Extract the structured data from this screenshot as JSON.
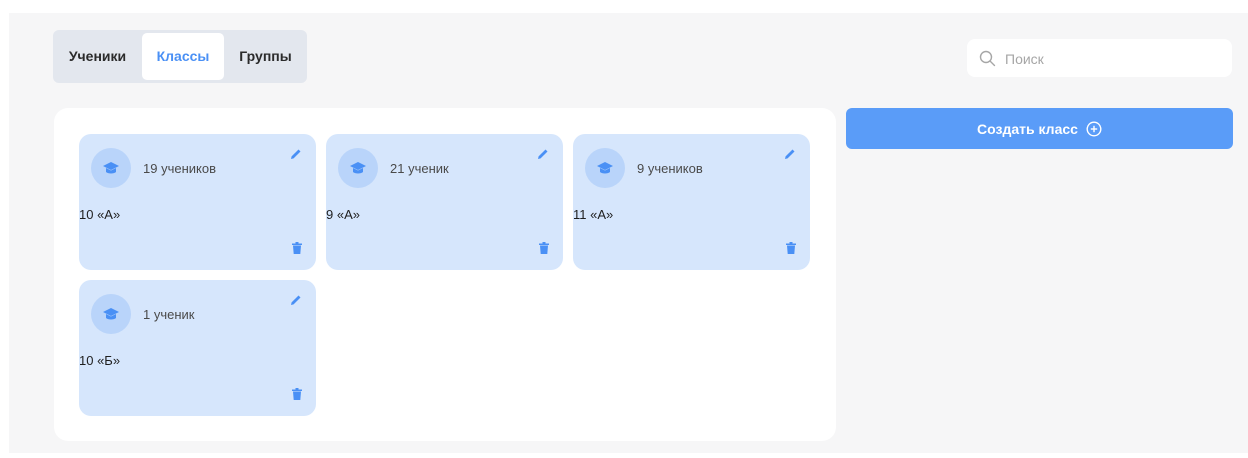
{
  "tabs": [
    {
      "label": "Ученики",
      "active": false
    },
    {
      "label": "Классы",
      "active": true
    },
    {
      "label": "Группы",
      "active": false
    }
  ],
  "search": {
    "placeholder": "Поиск",
    "icon": "search-icon"
  },
  "create_button": {
    "label": "Создать класс",
    "icon": "plus-circle-icon"
  },
  "classes": [
    {
      "name": "10 «А»",
      "count": "19 учеников"
    },
    {
      "name": "9 «А»",
      "count": "21 ученик"
    },
    {
      "name": "11 «А»",
      "count": "9 учеников"
    },
    {
      "name": "10 «Б»",
      "count": "1 ученик"
    }
  ],
  "colors": {
    "accent": "#5a9cf8",
    "card_bg": "#d6e6fc",
    "avatar_bg": "#b9d4fa",
    "icon": "#4a90f5",
    "page_bg": "#f6f6f7"
  }
}
